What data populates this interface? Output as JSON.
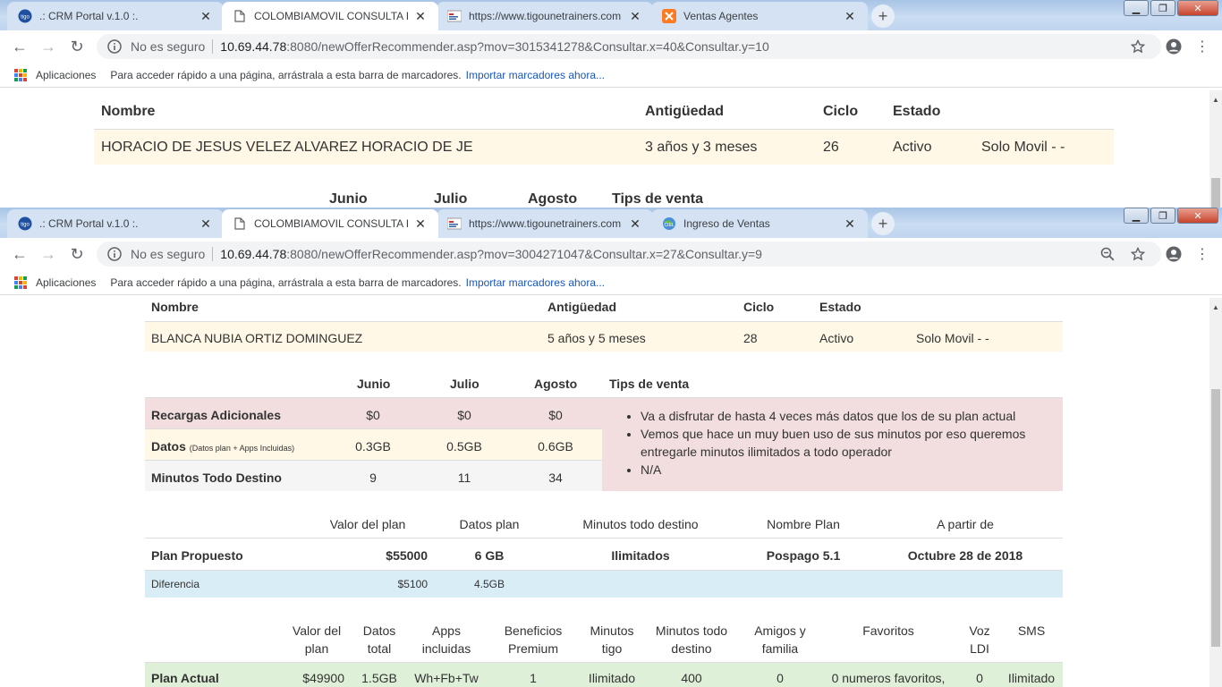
{
  "win1": {
    "tabs": [
      {
        "title": ".: CRM Portal v.1.0 :.",
        "icon": "tigo-icon",
        "active": false
      },
      {
        "title": "COLOMBIAMOVIL CONSULTA IN",
        "icon": "document-icon",
        "active": true
      },
      {
        "title": "https://www.tigounetrainers.com",
        "icon": "tigoune-icon",
        "active": false
      },
      {
        "title": "Ventas Agentes",
        "icon": "xampp-icon",
        "active": false
      }
    ],
    "url_security": "No es seguro",
    "url_host": "10.69.44.78",
    "url_path": ":8080/newOfferRecommender.asp?mov=3015341278&Consultar.x=40&Consultar.y=10",
    "headers": {
      "nombre": "Nombre",
      "antiguedad": "Antigüedad",
      "ciclo": "Ciclo",
      "estado": "Estado"
    },
    "customer": {
      "nombre": "HORACIO DE JESUS VELEZ ALVAREZ HORACIO DE JE",
      "antiguedad": "3 años y 3 meses",
      "ciclo": "26",
      "estado": "Activo",
      "tipo": "Solo Movil - -"
    },
    "months": [
      "Junio",
      "Julio",
      "Agosto"
    ],
    "tips_header": "Tips de venta"
  },
  "bookmarks": {
    "apps": "Aplicaciones",
    "hint": "Para acceder rápido a una página, arrástrala a esta barra de marcadores.",
    "import": "Importar marcadores ahora..."
  },
  "win2": {
    "tabs": [
      {
        "title": ".: CRM Portal v.1.0 :.",
        "icon": "tigo-icon",
        "active": false
      },
      {
        "title": "COLOMBIAMOVIL CONSULTA IN",
        "icon": "document-icon",
        "active": true
      },
      {
        "title": "https://www.tigounetrainers.com",
        "icon": "tigoune-icon",
        "active": false
      },
      {
        "title": "Ingreso de Ventas",
        "icon": "globe-icon",
        "active": false
      }
    ],
    "url_security": "No es seguro",
    "url_host": "10.69.44.78",
    "url_path": ":8080/newOfferRecommender.asp?mov=3004271047&Consultar.x=27&Consultar.y=9",
    "headers": {
      "nombre": "Nombre",
      "antiguedad": "Antigüedad",
      "ciclo": "Ciclo",
      "estado": "Estado"
    },
    "customer": {
      "nombre": "BLANCA NUBIA ORTIZ DOMINGUEZ",
      "antiguedad": "5 años y 5 meses",
      "ciclo": "28",
      "estado": "Activo",
      "tipo": "Solo Movil - -"
    },
    "usage": {
      "months": [
        "Junio",
        "Julio",
        "Agosto"
      ],
      "tips_header": "Tips de venta",
      "rows": [
        {
          "label": "Recargas Adicionales",
          "note": "",
          "values": [
            "$0",
            "$0",
            "$0"
          ]
        },
        {
          "label": "Datos",
          "note": "(Datos plan + Apps Incluidas)",
          "values": [
            "0.3GB",
            "0.5GB",
            "0.6GB"
          ]
        },
        {
          "label": "Minutos Todo Destino",
          "note": "",
          "values": [
            "9",
            "11",
            "34"
          ]
        }
      ],
      "tips": [
        "Va a disfrutar de hasta 4 veces más datos que los de su plan actual",
        "Vemos que hace un muy buen uso de sus minutos por eso queremos entregarle minutos ilimitados a todo operador",
        "N/A"
      ]
    },
    "proposed": {
      "headers": [
        "Valor del plan",
        "Datos plan",
        "Minutos todo destino",
        "Nombre Plan",
        "A partir de"
      ],
      "label": "Plan Propuesto",
      "valor": "$55000",
      "datos": "6 GB",
      "minutos": "Ilimitados",
      "nombre": "Pospago 5.1",
      "desde": "Octubre 28 de 2018",
      "diff_label": "Diferencia",
      "diff_valor": "$5100",
      "diff_datos": "4.5GB"
    },
    "current": {
      "headers": [
        {
          "l1": "Valor del",
          "l2": "plan"
        },
        {
          "l1": "Datos",
          "l2": "total"
        },
        {
          "l1": "Apps",
          "l2": "incluidas"
        },
        {
          "l1": "Beneficios",
          "l2": "Premium"
        },
        {
          "l1": "Minutos",
          "l2": "tigo"
        },
        {
          "l1": "Minutos todo",
          "l2": "destino"
        },
        {
          "l1": "Amigos y",
          "l2": "familia"
        },
        {
          "l1": "Favoritos",
          "l2": ""
        },
        {
          "l1": "Voz",
          "l2": "LDI"
        },
        {
          "l1": "SMS",
          "l2": ""
        }
      ],
      "label": "Plan Actual",
      "values": [
        "$49900",
        "1.5GB",
        "Wh+Fb+Tw",
        "1",
        "Ilimitado",
        "400",
        "0",
        "0 numeros favoritos,",
        "0",
        "Ilimitado"
      ]
    }
  },
  "colors": {
    "row_yellow": "#fff8e6",
    "row_pink": "#f2dede",
    "row_blue": "#d9edf7",
    "row_green": "#dff0d8",
    "tab_strip": "#bfd5ee",
    "link": "#1a55c4"
  }
}
